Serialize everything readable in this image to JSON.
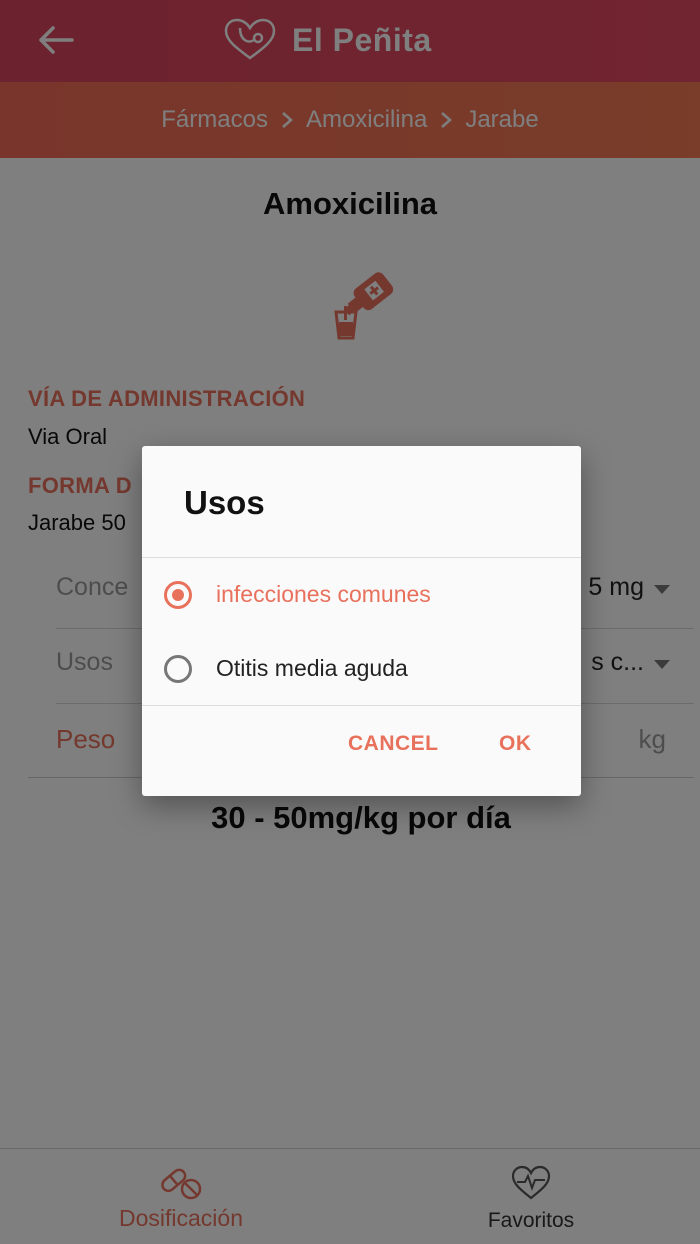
{
  "app": {
    "title": "El Peñita",
    "accent": "#e8715c",
    "header_color": "#d9465e"
  },
  "breadcrumb": {
    "items": [
      "Fármacos",
      "Amoxicilina",
      "Jarabe"
    ]
  },
  "drug": {
    "name": "Amoxicilina",
    "icon": "syrup-bottle-icon"
  },
  "route": {
    "label": "VÍA DE ADMINISTRACIÓN",
    "value": "Via Oral"
  },
  "form": {
    "label_visible": "FORMA D",
    "value_visible": "Jarabe 50"
  },
  "concentration": {
    "label_visible": "Conce",
    "value_visible": "5 mg"
  },
  "usos_field": {
    "label": "Usos",
    "value_visible": "s c..."
  },
  "weight": {
    "label": "Peso",
    "unit": "kg"
  },
  "dose": {
    "text": "30 - 50mg/kg por día"
  },
  "dialog": {
    "title": "Usos",
    "options": [
      {
        "label": "infecciones comunes",
        "selected": true
      },
      {
        "label": "Otitis media aguda",
        "selected": false
      }
    ],
    "cancel_label": "CANCEL",
    "ok_label": "OK"
  },
  "bottom_nav": {
    "items": [
      {
        "label": "Dosificación",
        "icon": "pills-icon",
        "active": true
      },
      {
        "label": "Favoritos",
        "icon": "heart-pulse-icon",
        "active": false
      }
    ]
  }
}
